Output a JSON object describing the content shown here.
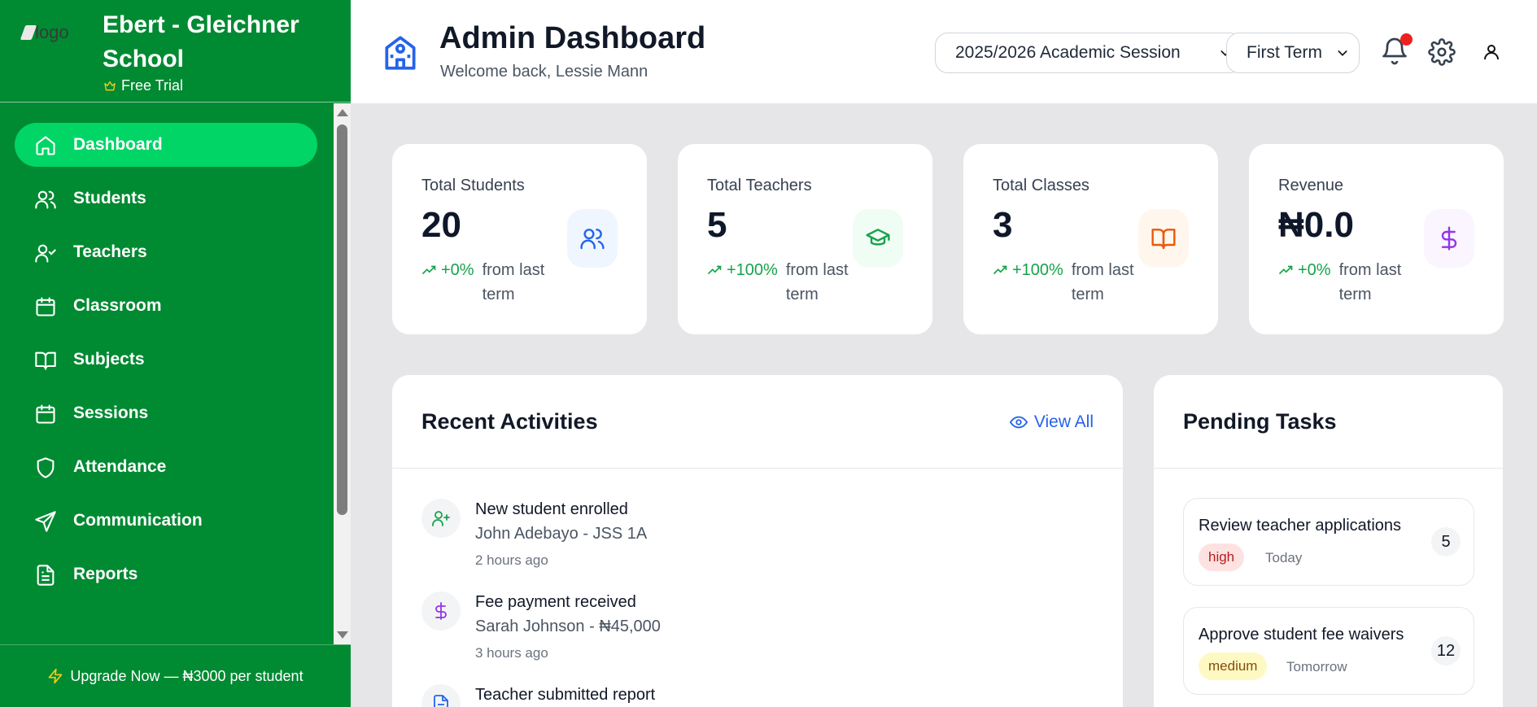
{
  "brand": {
    "logo_text": "logo",
    "school_name": "Ebert - Gleichner School",
    "plan": "Free Trial"
  },
  "sidebar": {
    "items": [
      {
        "label": "Dashboard",
        "icon": "home-icon",
        "active": true
      },
      {
        "label": "Students",
        "icon": "users-icon"
      },
      {
        "label": "Teachers",
        "icon": "user-check-icon"
      },
      {
        "label": "Classroom",
        "icon": "calendar-icon"
      },
      {
        "label": "Subjects",
        "icon": "book-open-icon"
      },
      {
        "label": "Sessions",
        "icon": "calendar-icon"
      },
      {
        "label": "Attendance",
        "icon": "shield-icon"
      },
      {
        "label": "Communication",
        "icon": "send-icon"
      },
      {
        "label": "Reports",
        "icon": "file-text-icon"
      }
    ],
    "upgrade_label": "Upgrade Now — ₦3000 per student"
  },
  "header": {
    "title": "Admin Dashboard",
    "welcome": "Welcome back, Lessie Mann",
    "session_select": "2025/2026 Academic Session",
    "term_select": "First Term"
  },
  "stats": [
    {
      "label": "Total Students",
      "value": "20",
      "change": "+0%",
      "from": "from last term",
      "icon": "users-icon",
      "color": "#2563eb",
      "bg": "#eff6ff"
    },
    {
      "label": "Total Teachers",
      "value": "5",
      "change": "+100%",
      "from": "from last term",
      "icon": "graduation-cap-icon",
      "color": "#16a34a",
      "bg": "#f0fdf4"
    },
    {
      "label": "Total Classes",
      "value": "3",
      "change": "+100%",
      "from": "from last term",
      "icon": "book-open-icon",
      "color": "#ea580c",
      "bg": "#fff7ed"
    },
    {
      "label": "Revenue",
      "value": "₦0.0",
      "change": "+0%",
      "from": "from last term",
      "icon": "dollar-icon",
      "color": "#9333ea",
      "bg": "#faf5ff"
    }
  ],
  "activities": {
    "title": "Recent Activities",
    "view_all": "View All",
    "items": [
      {
        "title": "New student enrolled",
        "subtitle": "John Adebayo - JSS 1A",
        "time": "2 hours ago",
        "icon": "user-plus-icon"
      },
      {
        "title": "Fee payment received",
        "subtitle": "Sarah Johnson - ₦45,000",
        "time": "3 hours ago",
        "icon": "dollar-icon"
      },
      {
        "title": "Teacher submitted report",
        "subtitle": "",
        "time": "",
        "icon": "file-text-icon"
      }
    ]
  },
  "tasks": {
    "title": "Pending Tasks",
    "items": [
      {
        "title": "Review teacher applications",
        "priority": "high",
        "due": "Today",
        "count": "5"
      },
      {
        "title": "Approve student fee waivers",
        "priority": "medium",
        "due": "Tomorrow",
        "count": "12"
      }
    ]
  },
  "colors": {
    "sidebar_bg": "#008a32",
    "active_item": "#00d566",
    "accent_blue": "#2563eb",
    "notification_dot": "#ef2020"
  }
}
